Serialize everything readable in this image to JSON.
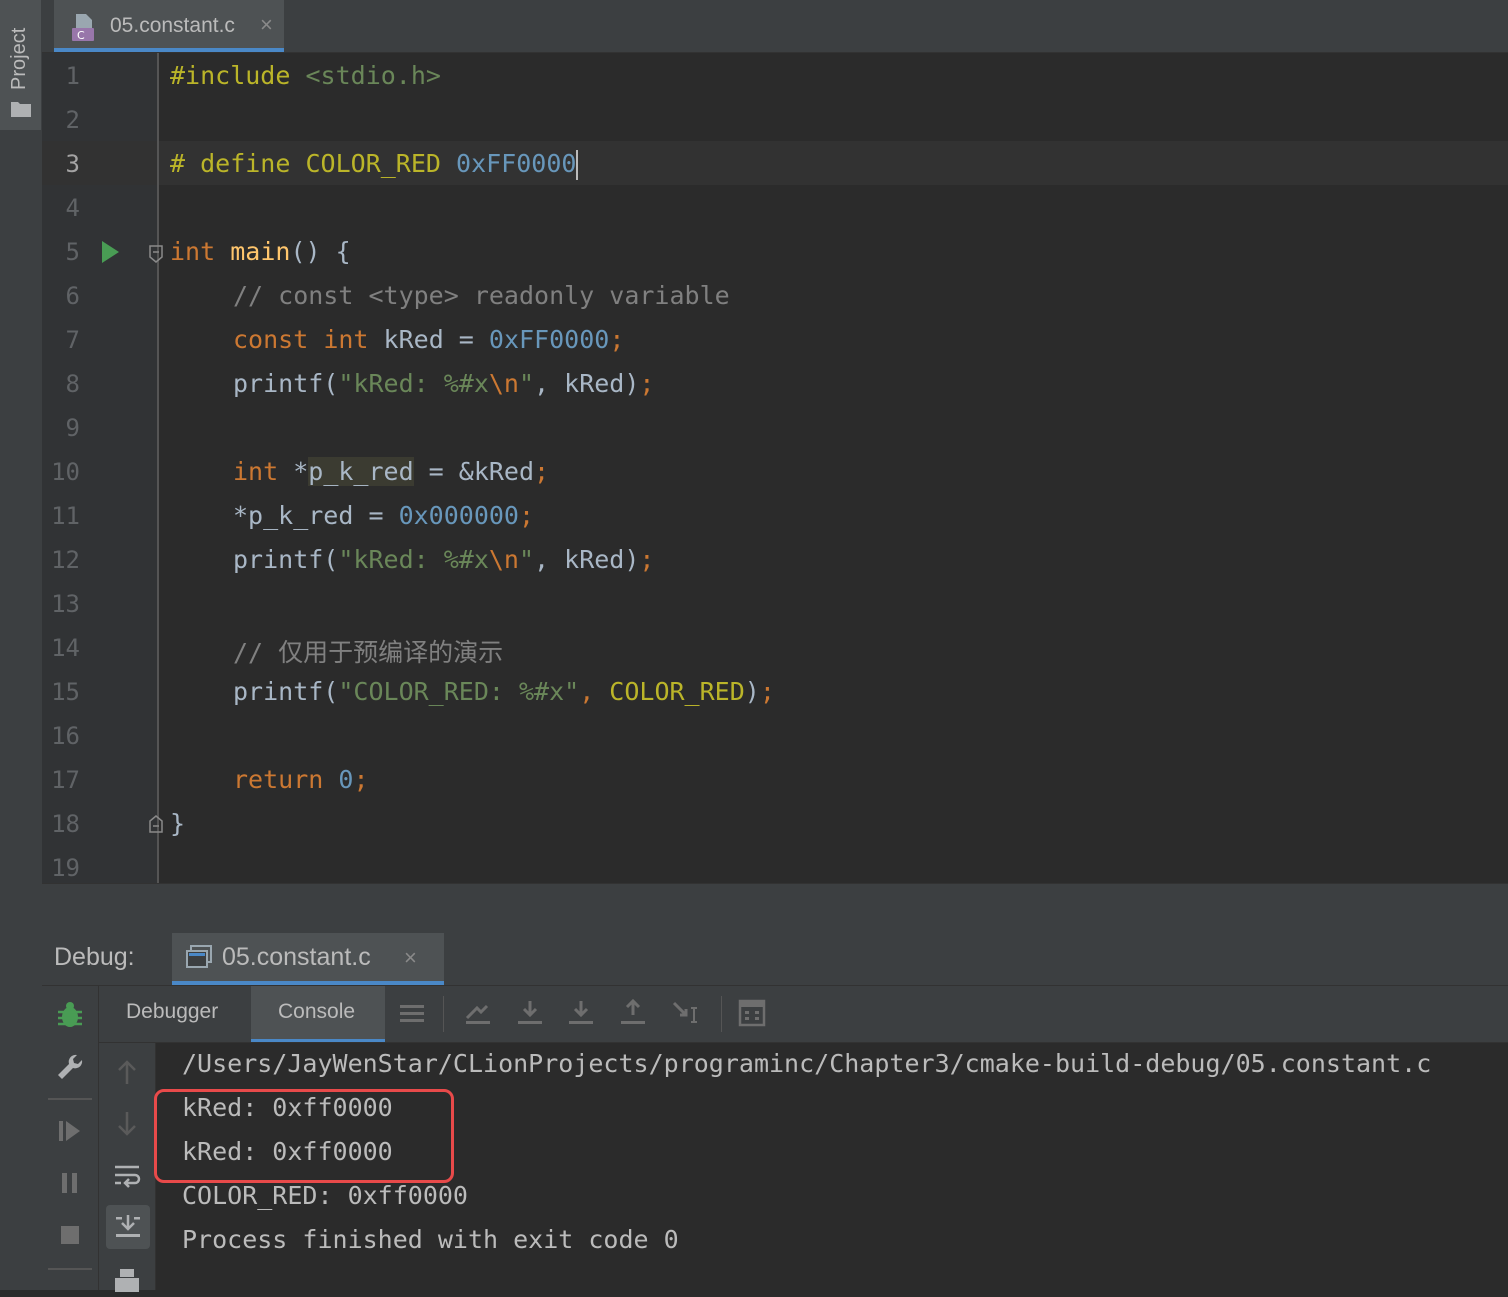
{
  "project_panel": {
    "label": "Project",
    "folder_icon": "folder-icon"
  },
  "editor_tab": {
    "filename": "05.constant.c",
    "icon": "c-file-icon",
    "close": "×"
  },
  "editor": {
    "current_line": 3,
    "line_numbers": [
      "1",
      "2",
      "3",
      "4",
      "5",
      "6",
      "7",
      "8",
      "9",
      "10",
      "11",
      "12",
      "13",
      "14",
      "15",
      "16",
      "17",
      "18",
      "19"
    ],
    "lines": {
      "l1": {
        "directive": "#include",
        "header": "<stdio.h>"
      },
      "l3": {
        "directive": "# define",
        "macro": "COLOR_RED",
        "value": "0xFF0000"
      },
      "l5": {
        "type": "int",
        "name": "main",
        "rest": "() {"
      },
      "l6": {
        "comment": "// const <type> readonly variable"
      },
      "l7": {
        "kw1": "const",
        "kw2": "int",
        "var": " kRed = ",
        "value": "0xFF0000",
        "semi": ";"
      },
      "l8": {
        "fn": "printf(",
        "str1": "\"kRed: %#x",
        "esc": "\\n",
        "str2": "\"",
        "rest": ", kRed)",
        "semi": ";"
      },
      "l10": {
        "kw": "int",
        "star": " *",
        "var": "p_k_red",
        "rest": " = &kRed",
        "semi": ";"
      },
      "l11": {
        "lhs": "*p_k_red = ",
        "value": "0x000000",
        "semi": ";"
      },
      "l12": {
        "fn": "printf(",
        "str1": "\"kRed: %#x",
        "esc": "\\n",
        "str2": "\"",
        "rest": ", kRed)",
        "semi": ";"
      },
      "l14": {
        "comment": "// 仅用于预编译的演示"
      },
      "l15": {
        "fn": "printf(",
        "str": "\"COLOR_RED: %#x\"",
        "sep": ", ",
        "macro": "COLOR_RED",
        "close": ")",
        "semi": ";"
      },
      "l17": {
        "kw": "return",
        "sp": " ",
        "value": "0",
        "semi": ";"
      },
      "l18": {
        "brace": "}"
      }
    }
  },
  "debug": {
    "title": "Debug:",
    "tab_name": "05.constant.c",
    "tab_close": "×",
    "tabs": {
      "debugger": "Debugger",
      "console": "Console"
    },
    "console_lines": [
      "/Users/JayWenStar/CLionProjects/programinc/Chapter3/cmake-build-debug/05.constant.c",
      "kRed: 0xff0000",
      "kRed: 0xff0000",
      "COLOR_RED: 0xff0000",
      "Process finished with exit code 0"
    ]
  },
  "colors": {
    "accent": "#4a88c7",
    "highlight_box": "#e84a4a",
    "run": "#499c54"
  }
}
